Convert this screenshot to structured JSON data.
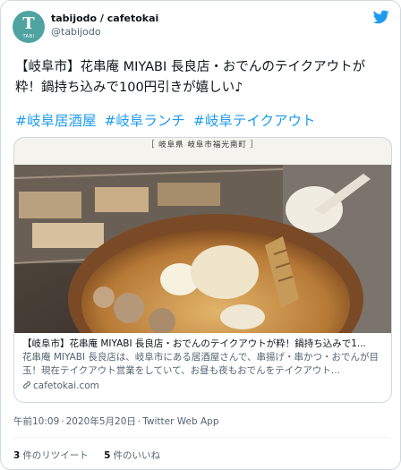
{
  "user": {
    "avatar_big": "T",
    "avatar_small": "TABI",
    "display_name": "tabijodo / cafetokai",
    "handle": "@tabijodo",
    "avatar_color": "#4fa3a0"
  },
  "logo_icon": "twitter-bird-icon",
  "tweet": {
    "text": "【岐阜市】花串庵 MIYABI 長良店・おでんのテイクアウトが粋！鍋持ち込みで100円引きが嬉しい♪",
    "hashtags": [
      "#岐阜居酒屋",
      "#岐阜ランチ",
      "#岐阜テイクアウト"
    ]
  },
  "link_card": {
    "photo_location": "［ 岐阜県 岐阜市福光南町 ］",
    "title": "【岐阜市】花串庵 MIYABI 長良店・おでんのテイクアウトが粋！鍋持ち込みで1...",
    "description": "花串庵 MIYABI 長良店は、岐阜市にある居酒屋さんで、串揚げ・串かつ・おでんが目玉！現在テイクアウト営業をしていて、お昼も夜もおでんをテイクアウト...",
    "domain": "cafetokai.com"
  },
  "meta": {
    "time": "午前10:09",
    "date": "2020年5月20日",
    "source": "Twitter Web App"
  },
  "stats": {
    "retweet_count": "3",
    "retweet_label": "件のリツイート",
    "like_count": "5",
    "like_label": "件のいいね"
  },
  "colors": {
    "accent": "#1d9bf0",
    "secondary_text": "#536471",
    "border": "#cfd9de"
  }
}
